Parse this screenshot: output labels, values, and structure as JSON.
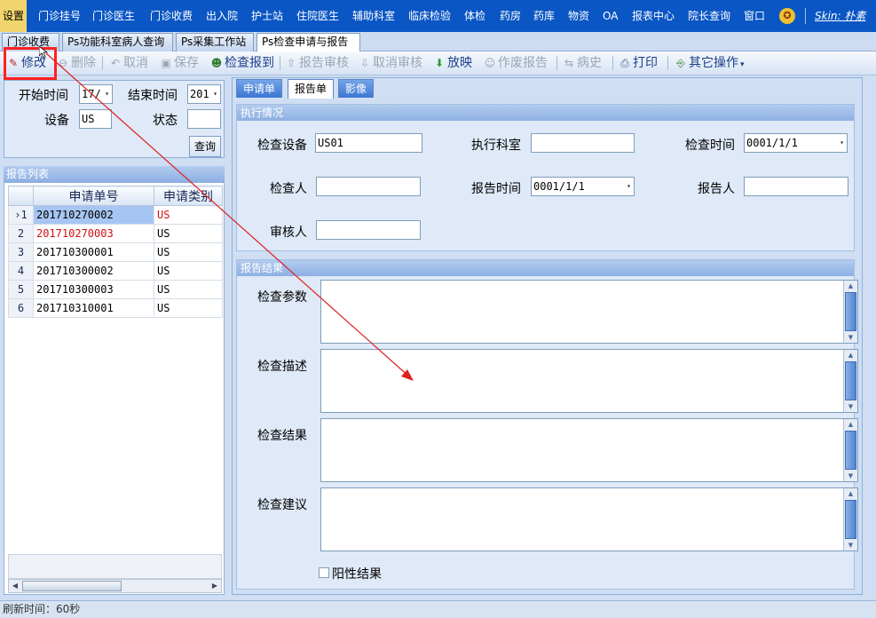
{
  "menu": {
    "items": [
      "设置",
      "门诊挂号",
      "门诊医生",
      "门诊收费",
      "出入院",
      "护士站",
      "住院医生",
      "辅助科室",
      "临床检验",
      "体检",
      "药房",
      "药库",
      "物资",
      "OA",
      "报表中心",
      "院长查询",
      "窗口"
    ],
    "skin_label": "Skin: 朴素"
  },
  "tabs": [
    "门诊收费",
    "Ps功能科室病人查询",
    "Ps采集工作站",
    "Ps检查申请与报告"
  ],
  "toolbar": {
    "edit": "修改",
    "delete": "删除",
    "cancel": "取消",
    "save": "保存",
    "check_in": "检查报到",
    "audit": "报告审核",
    "cancel_audit": "取消审核",
    "release": "放映",
    "void_report": "作废报告",
    "history": "病史",
    "print": "打印",
    "other": "其它操作"
  },
  "query": {
    "start_label": "开始时间",
    "start_value": "17/",
    "end_label": "结束时间",
    "end_value": "201",
    "device_label": "设备",
    "device_value": "US",
    "status_label": "状态",
    "status_value": "",
    "search_button": "查询"
  },
  "report_list": {
    "title": "报告列表",
    "columns": [
      "申请单号",
      "申请类别"
    ],
    "rows": [
      {
        "idx": "1",
        "marker": "›",
        "no": "201710270002",
        "type": "US",
        "highlight": true
      },
      {
        "idx": "2",
        "marker": "",
        "no": "201710270003",
        "type": "US",
        "highlight": false
      },
      {
        "idx": "3",
        "marker": "",
        "no": "201710300001",
        "type": "US",
        "highlight": false
      },
      {
        "idx": "4",
        "marker": "",
        "no": "201710300002",
        "type": "US",
        "highlight": false
      },
      {
        "idx": "5",
        "marker": "",
        "no": "201710300003",
        "type": "US",
        "highlight": false
      },
      {
        "idx": "6",
        "marker": "",
        "no": "201710310001",
        "type": "US",
        "highlight": false
      }
    ]
  },
  "detail_tabs": [
    "申请单",
    "报告单",
    "影像"
  ],
  "exec_section": {
    "title": "执行情况",
    "device_label": "检查设备",
    "device_value": "US01",
    "dept_label": "执行科室",
    "dept_value": "",
    "time_label": "检查时间",
    "time_value": "0001/1/1",
    "checker_label": "检查人",
    "checker_value": "",
    "report_time_label": "报告时间",
    "report_time_value": "0001/1/1",
    "reporter_label": "报告人",
    "reporter_value": "",
    "auditor_label": "审核人",
    "auditor_value": ""
  },
  "result_section": {
    "title": "报告结果",
    "params_label": "检查参数",
    "desc_label": "检查描述",
    "result_label": "检查结果",
    "advice_label": "检查建议",
    "positive_label": "阳性结果"
  },
  "status_bar": {
    "text": "刷新时间：60秒"
  },
  "colors": {
    "menu_bg": "#0a56c4",
    "highlight_box": "#ff2020",
    "annotation_arrow": "#e02020"
  }
}
